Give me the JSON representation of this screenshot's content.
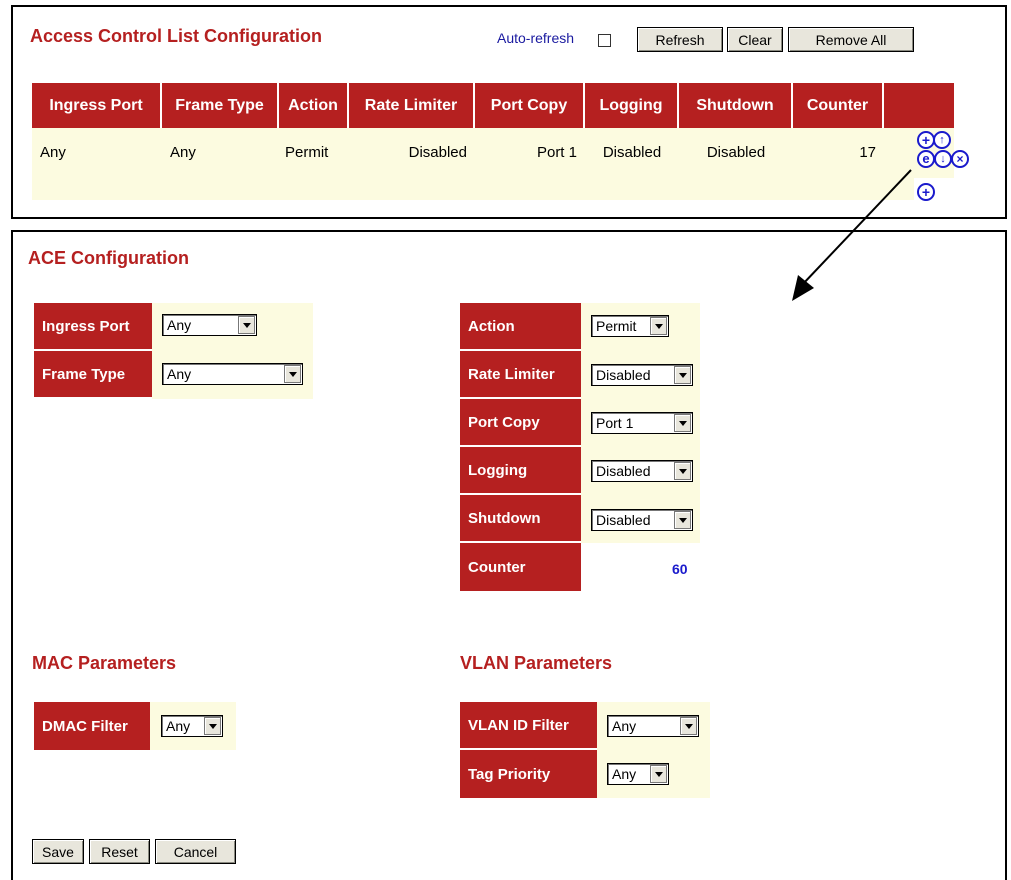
{
  "acl": {
    "title": "Access Control List Configuration",
    "auto_refresh_label": "Auto-refresh",
    "auto_refresh_checked": false,
    "buttons": {
      "refresh": "Refresh",
      "clear": "Clear",
      "remove_all": "Remove All"
    },
    "columns": [
      "Ingress Port",
      "Frame Type",
      "Action",
      "Rate Limiter",
      "Port Copy",
      "Logging",
      "Shutdown",
      "Counter"
    ],
    "rows": [
      {
        "ingress_port": "Any",
        "frame_type": "Any",
        "action": "Permit",
        "rate_limiter": "Disabled",
        "port_copy": "Port 1",
        "logging": "Disabled",
        "shutdown": "Disabled",
        "counter": "17"
      }
    ],
    "row_actions": [
      "insert-new-icon",
      "move-up-icon",
      "edit-icon",
      "move-down-icon",
      "delete-icon",
      "add-new-icon"
    ]
  },
  "ace": {
    "title": "ACE Configuration",
    "ingress_port": {
      "label": "Ingress Port",
      "value": "Any"
    },
    "frame_type": {
      "label": "Frame Type",
      "value": "Any"
    },
    "action": {
      "label": "Action",
      "value": "Permit"
    },
    "rate_limiter": {
      "label": "Rate Limiter",
      "value": "Disabled"
    },
    "port_copy": {
      "label": "Port Copy",
      "value": "Port 1"
    },
    "logging": {
      "label": "Logging",
      "value": "Disabled"
    },
    "shutdown": {
      "label": "Shutdown",
      "value": "Disabled"
    },
    "counter": {
      "label": "Counter",
      "value": "60"
    },
    "mac": {
      "title": "MAC Parameters",
      "dmac_filter": {
        "label": "DMAC Filter",
        "value": "Any"
      }
    },
    "vlan": {
      "title": "VLAN Parameters",
      "vlan_id_filter": {
        "label": "VLAN ID Filter",
        "value": "Any"
      },
      "tag_priority": {
        "label": "Tag Priority",
        "value": "Any"
      }
    },
    "buttons": {
      "save": "Save",
      "reset": "Reset",
      "cancel": "Cancel"
    }
  },
  "colors": {
    "header_red": "#b52020",
    "field_cream": "#fcfbe0",
    "icon_blue": "#1a1acc"
  }
}
